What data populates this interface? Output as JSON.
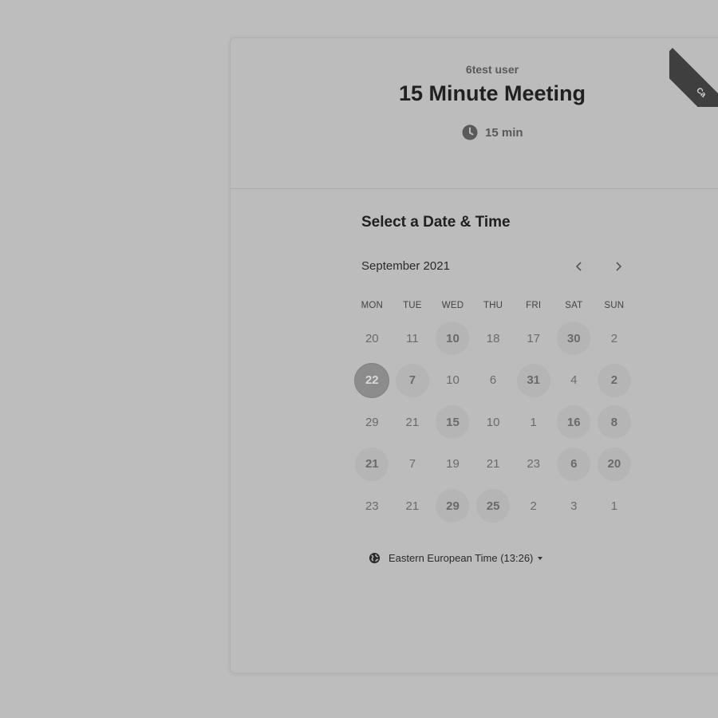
{
  "host": {
    "name": "6test user"
  },
  "event": {
    "title": "15 Minute Meeting",
    "duration": "15 min"
  },
  "ribbon": {
    "label": "Ca"
  },
  "scheduler": {
    "section_title": "Select a Date & Time",
    "month_label": "September 2021",
    "weekdays": [
      "MON",
      "TUE",
      "WED",
      "THU",
      "FRI",
      "SAT",
      "SUN"
    ],
    "weeks": [
      [
        {
          "d": "20",
          "s": "u"
        },
        {
          "d": "11",
          "s": "u"
        },
        {
          "d": "10",
          "s": "a"
        },
        {
          "d": "18",
          "s": "u"
        },
        {
          "d": "17",
          "s": "u"
        },
        {
          "d": "30",
          "s": "a"
        },
        {
          "d": "2",
          "s": "u"
        }
      ],
      [
        {
          "d": "22",
          "s": "sel"
        },
        {
          "d": "7",
          "s": "a"
        },
        {
          "d": "10",
          "s": "u"
        },
        {
          "d": "6",
          "s": "u"
        },
        {
          "d": "31",
          "s": "a"
        },
        {
          "d": "4",
          "s": "u"
        },
        {
          "d": "2",
          "s": "a"
        }
      ],
      [
        {
          "d": "29",
          "s": "u"
        },
        {
          "d": "21",
          "s": "u"
        },
        {
          "d": "15",
          "s": "a"
        },
        {
          "d": "10",
          "s": "u"
        },
        {
          "d": "1",
          "s": "u"
        },
        {
          "d": "16",
          "s": "a"
        },
        {
          "d": "8",
          "s": "a"
        }
      ],
      [
        {
          "d": "21",
          "s": "a"
        },
        {
          "d": "7",
          "s": "u"
        },
        {
          "d": "19",
          "s": "u"
        },
        {
          "d": "21",
          "s": "u"
        },
        {
          "d": "23",
          "s": "u"
        },
        {
          "d": "6",
          "s": "a"
        },
        {
          "d": "20",
          "s": "a"
        }
      ],
      [
        {
          "d": "23",
          "s": "u"
        },
        {
          "d": "21",
          "s": "u"
        },
        {
          "d": "29",
          "s": "a"
        },
        {
          "d": "25",
          "s": "a"
        },
        {
          "d": "2",
          "s": "u"
        },
        {
          "d": "3",
          "s": "u"
        },
        {
          "d": "1",
          "s": "u"
        }
      ]
    ],
    "timezone": {
      "label": "Eastern European Time (13:26)"
    }
  },
  "icons": {
    "duration": "clock-icon",
    "timezone": "globe-icon",
    "prev": "chevron-left-icon",
    "next": "chevron-right-icon",
    "dropdown": "caret-down-icon"
  },
  "colors": {
    "background": "#bdbdbd",
    "selected_day": "#8c8c8c",
    "available_day": "#b5b5b5"
  }
}
